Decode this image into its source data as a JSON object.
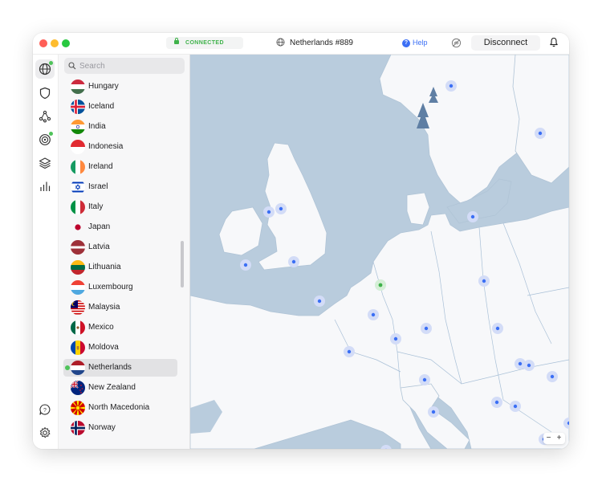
{
  "titlebar": {
    "status": "CONNECTED",
    "server": "Netherlands #889",
    "help": "Help",
    "disconnect": "Disconnect"
  },
  "search": {
    "placeholder": "Search"
  },
  "countries": [
    {
      "name": "Hungary"
    },
    {
      "name": "Iceland"
    },
    {
      "name": "India"
    },
    {
      "name": "Indonesia"
    },
    {
      "name": "Ireland"
    },
    {
      "name": "Israel"
    },
    {
      "name": "Italy"
    },
    {
      "name": "Japan"
    },
    {
      "name": "Latvia"
    },
    {
      "name": "Lithuania"
    },
    {
      "name": "Luxembourg"
    },
    {
      "name": "Malaysia"
    },
    {
      "name": "Mexico"
    },
    {
      "name": "Moldova"
    },
    {
      "name": "Netherlands",
      "selected": true
    },
    {
      "name": "New Zealand"
    },
    {
      "name": "North Macedonia"
    },
    {
      "name": "Norway"
    }
  ],
  "map": {
    "zoom_out": "−",
    "zoom_in": "+"
  },
  "colors": {
    "connected": "#3fb24a",
    "accent": "#3b6ff5",
    "sea": "#b9ccdd",
    "land": "#f7f8fa",
    "marker": "#3b6ff5"
  }
}
